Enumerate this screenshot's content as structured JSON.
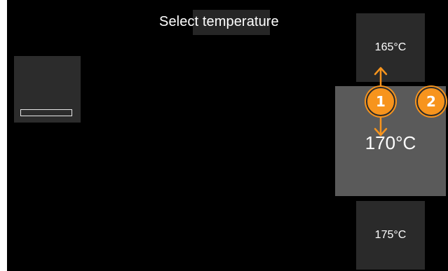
{
  "screen": {
    "title": "Select temperature"
  },
  "temperature_picker": {
    "upper_option": "165°C",
    "selected_option": "170°C",
    "lower_option": "175°C"
  },
  "annotations": {
    "badge_1": "1",
    "badge_2": "2",
    "color": "#f7941d"
  },
  "icons": {
    "mode_tile": "mode-bar-icon",
    "scroll_arrows": "up-down-arrow-icon"
  }
}
